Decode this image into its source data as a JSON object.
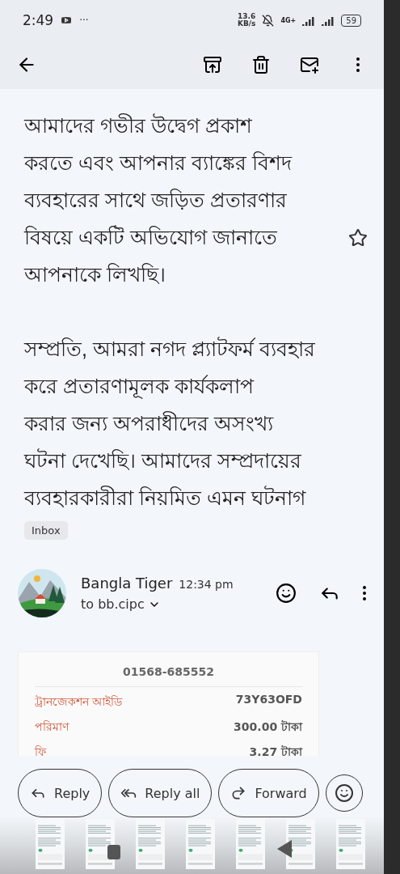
{
  "status_bar": {
    "time": "2:49",
    "more": "···",
    "speed": "13.6",
    "speed_unit": "KB/s",
    "network": "4G+",
    "battery": "59"
  },
  "message": {
    "paragraphs": [
      {
        "lines": [
          "আমাদের গভীর উদ্বেগ প্রকাশ",
          "করতে এবং আপনার ব্যাঙ্কের বিশদ",
          "ব্যবহারের সাথে জড়িত প্রতারণার",
          "বিষয়ে একটি অভিযোগ জানাতে",
          "আপনাকে লিখছি।"
        ]
      },
      {
        "lines": [
          "সম্প্রতি, আমরা নগদ প্ল্যাটফর্ম ব্যবহার",
          "করে প্রতারণামূলক কার্যকলাপ",
          "করার জন্য অপরাধীদের অসংখ্য",
          "ঘটনা দেখেছি। আমাদের সম্প্রদায়ের",
          "ব্যবহারকারীরা নিয়মিত এমন ঘটনাগ"
        ]
      }
    ],
    "starred": false,
    "label": "Inbox"
  },
  "sender": {
    "name": "Bangla Tiger",
    "time": "12:34 pm",
    "recipient": "to bb.cipc"
  },
  "receipt": {
    "phone": "01568-685552",
    "rows": [
      {
        "label": "ট্রানজেকশন আইডি",
        "value": "73Y63OFD"
      },
      {
        "label": "পরিমাণ",
        "value": "300.00 টাকা"
      },
      {
        "label": "ফি",
        "value": "3.27 টাকা"
      }
    ]
  },
  "actions": [
    {
      "kind": "reply",
      "label": "Reply"
    },
    {
      "kind": "reply_all",
      "label": "Reply all"
    },
    {
      "kind": "forward",
      "label": "Forward"
    },
    {
      "kind": "react"
    }
  ]
}
